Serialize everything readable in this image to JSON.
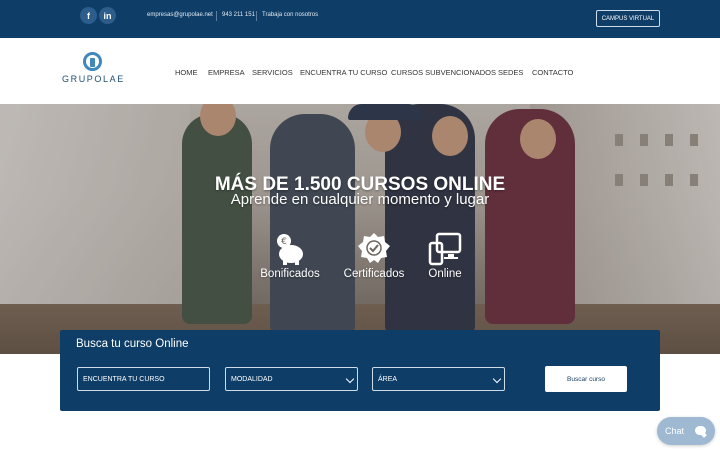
{
  "topbar": {
    "social": [
      {
        "icon": "facebook-icon",
        "glyph": "f"
      },
      {
        "icon": "linkedin-icon",
        "glyph": "in"
      }
    ],
    "email": "empresas@grupolae.net",
    "phone": "943 211 151",
    "work_link": "Trabaja con nosotros",
    "campus_button": "CAMPUS VIRTUAL"
  },
  "header": {
    "logo_text": "GRUPOLAE",
    "nav": [
      "HOME",
      "EMPRESA",
      "SERVICIOS",
      "ENCUENTRA TU CURSO",
      "CURSOS SUBVENCIONADOS",
      "SEDES",
      "CONTACTO"
    ]
  },
  "hero": {
    "title": "MÁS DE 1.500 CURSOS ONLINE",
    "subtitle": "Aprende en cualquier momento y lugar",
    "features": [
      {
        "label": "Bonificados",
        "icon": "piggy-bank-euro-icon"
      },
      {
        "label": "Certificados",
        "icon": "certificate-badge-icon"
      },
      {
        "label": "Online",
        "icon": "devices-icon"
      }
    ]
  },
  "search": {
    "title": "Busca tu curso Online",
    "course_placeholder": "ENCUENTRA TU CURSO",
    "modalidad_selected": "MODALIDAD",
    "area_selected": "ÁREA",
    "button": "Buscar curso"
  },
  "chat": {
    "label": "Chat"
  },
  "colors": {
    "primary": "#0e3d67",
    "accent": "#3f87bd"
  }
}
